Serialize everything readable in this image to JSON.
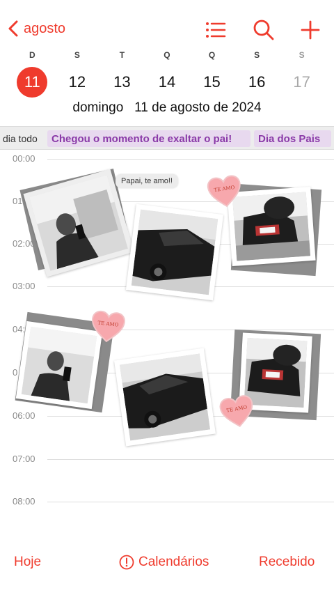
{
  "header": {
    "back_label": "agosto",
    "icons": [
      "list-icon",
      "search-icon",
      "plus-icon"
    ]
  },
  "week": {
    "days": [
      {
        "abbr": "D",
        "num": "11",
        "selected": true
      },
      {
        "abbr": "S",
        "num": "12"
      },
      {
        "abbr": "T",
        "num": "13"
      },
      {
        "abbr": "Q",
        "num": "14"
      },
      {
        "abbr": "Q",
        "num": "15"
      },
      {
        "abbr": "S",
        "num": "16"
      },
      {
        "abbr": "S",
        "num": "17",
        "dim": true
      }
    ],
    "full_date": "domingo   11 de agosto de 2024"
  },
  "all_day": {
    "label": "dia todo",
    "events": [
      "Chegou o momento de exaltar o pai!",
      "Dia dos Pais"
    ]
  },
  "timeline": {
    "hours": [
      "00:00",
      "01:",
      "02:00",
      "03:00",
      "04:",
      "0",
      "06:00",
      "07:00",
      "08:00"
    ]
  },
  "collage": {
    "bubble": "Papai, te amo!!",
    "heart_text": "TE AMO"
  },
  "toolbar": {
    "today": "Hoje",
    "calendars": "Calendários",
    "inbox": "Recebido"
  },
  "colors": {
    "accent": "#ef3b2d",
    "event_bg": "#e8d9ef",
    "event_text": "#8a3aa8"
  }
}
